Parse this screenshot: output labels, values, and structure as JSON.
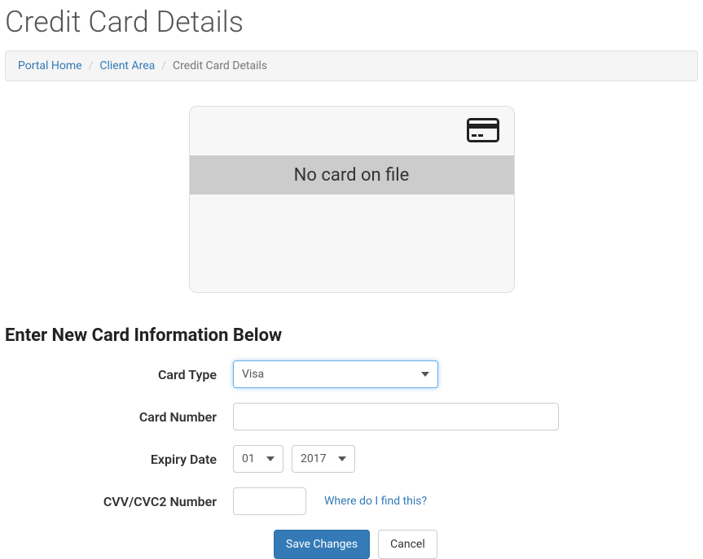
{
  "page_title": "Credit Card Details",
  "breadcrumb": {
    "items": [
      {
        "label": "Portal Home",
        "link": true
      },
      {
        "label": "Client Area",
        "link": true
      },
      {
        "label": "Credit Card Details",
        "link": false
      }
    ]
  },
  "card_display": {
    "status_text": "No card on file"
  },
  "form": {
    "heading": "Enter New Card Information Below",
    "card_type": {
      "label": "Card Type",
      "selected": "Visa"
    },
    "card_number": {
      "label": "Card Number",
      "value": ""
    },
    "expiry": {
      "label": "Expiry Date",
      "month_selected": "01",
      "year_selected": "2017"
    },
    "cvv": {
      "label": "CVV/CVC2 Number",
      "value": "",
      "helper_text": "Where do I find this?"
    },
    "buttons": {
      "save": "Save Changes",
      "cancel": "Cancel"
    }
  }
}
